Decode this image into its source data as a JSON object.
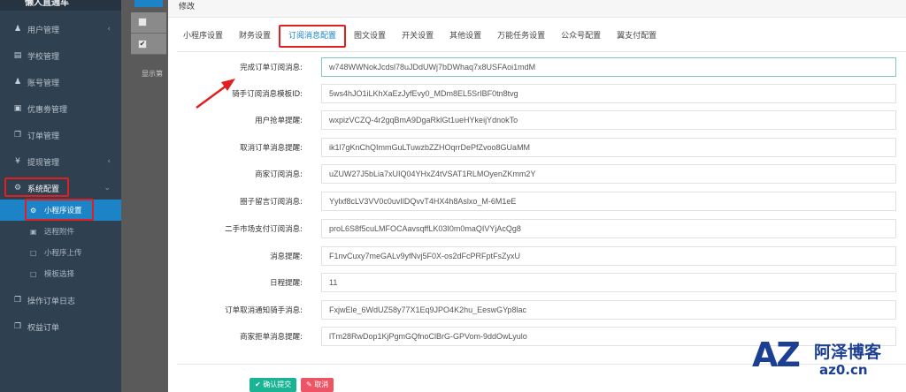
{
  "sidebar": {
    "brand": "懒人直通车",
    "items": [
      {
        "label": "用户管理",
        "icon": "user-icon"
      },
      {
        "label": "学校管理",
        "icon": "document-icon"
      },
      {
        "label": "账号管理",
        "icon": "users-icon"
      },
      {
        "label": "优惠劵管理",
        "icon": "card-icon"
      },
      {
        "label": "订单管理",
        "icon": "copy-icon"
      },
      {
        "label": "提现管理",
        "icon": "yen-icon"
      },
      {
        "label": "系统配置",
        "icon": "gear-icon"
      }
    ],
    "sub_items": [
      {
        "label": "小程序设置",
        "icon": "gear-icon"
      },
      {
        "label": "远程附件",
        "icon": "image-icon"
      },
      {
        "label": "小程序上传",
        "icon": "file-icon"
      },
      {
        "label": "模板选择",
        "icon": "file-icon"
      }
    ],
    "bottom_items": [
      {
        "label": "操作订单日志",
        "icon": "copy-icon"
      },
      {
        "label": "权益订单",
        "icon": "copy-icon"
      }
    ]
  },
  "background": {
    "text": "显示第",
    "check_mark": "✔"
  },
  "modal": {
    "title": "修改",
    "tabs": [
      "小程序设置",
      "财务设置",
      "订阅消息配置",
      "图文设置",
      "开关设置",
      "其他设置",
      "万能任务设置",
      "公众号配置",
      "翼支付配置"
    ],
    "active_tab": "订阅消息配置",
    "fields": [
      {
        "label": "完成订单订阅消息:",
        "value": "w748WWNokJcdsl78uJDdUWj7bDWhaq7x8USFAoi1mdM"
      },
      {
        "label": "骑手订阅消息模板ID:",
        "value": "5ws4hJO1iLKhXaEzJyfEvy0_MDm8EL5SrIBF0tn8tvg"
      },
      {
        "label": "用户抢单提醒:",
        "value": "wxpizVCZQ-4r2gqBmA9DgaRklGt1ueHYkeijYdnokTo"
      },
      {
        "label": "取消订单消息提醒:",
        "value": "ik1l7gKnChQImmGuLTuwzbZZHOqrrDePfZvoo8GUaMM"
      },
      {
        "label": "商家订阅消息:",
        "value": "uZUW27J5bLia7xUIQ04YHxZ4tVSAT1RLMOyenZKmm2Y"
      },
      {
        "label": "圈子留言订阅消息:",
        "value": "Yylxf8cLV3VV0c0uvIlDQvvT4HX4h8Aslxo_M-6M1eE"
      },
      {
        "label": "二手市场支付订阅消息:",
        "value": "proL6S8f5cuLMFOCAavsqffLK03I0m0maQIVYjAcQg8"
      },
      {
        "label": "消息提醒:",
        "value": "F1nvCuxy7meGALv9yfNvj5F0X-os2dFcPRFptFsZyxU"
      },
      {
        "label": "日程提醒:",
        "value": "11"
      },
      {
        "label": "订单取消通知骑手消息:",
        "value": "FxjwEle_6WdUZ58y77X1Eq9JPO4K2hu_EeswGYp8lac"
      },
      {
        "label": "商家拒单消息提醒:",
        "value": "lTm28RwDop1KjPgmGQfnoClBrG-GPVom-9ddOwLyulo"
      }
    ],
    "confirm_label": "确认提交",
    "cancel_label": "取消"
  },
  "watermark": {
    "logo": "AZ",
    "name": "阿泽博客",
    "url": "az0.cn"
  },
  "colors": {
    "sidebar_bg": "#2f4050",
    "accent": "#1c84c6",
    "highlight": "#e02020",
    "confirm": "#1ab394",
    "cancel": "#ed5565",
    "watermark": "#1c3f94"
  }
}
